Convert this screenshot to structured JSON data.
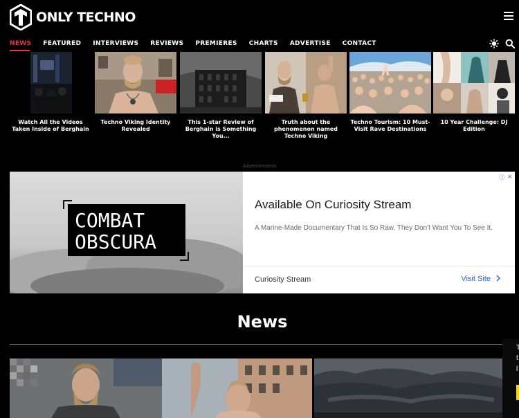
{
  "site": {
    "logo_text": "ONLY TECHNO"
  },
  "nav": {
    "items": [
      {
        "label": "NEWS",
        "active": true
      },
      {
        "label": "FEATURED"
      },
      {
        "label": "INTERVIEWS"
      },
      {
        "label": "REVIEWS"
      },
      {
        "label": "PREMIERES"
      },
      {
        "label": "CHARTS"
      },
      {
        "label": "ADVERTISE"
      },
      {
        "label": "CONTACT"
      }
    ],
    "accent_color": "#e8363a"
  },
  "carousel": {
    "cards": [
      {
        "title": "Watch All the Videos Taken Inside of Berghain"
      },
      {
        "title": "Techno Viking Identity Revealed"
      },
      {
        "title": "This 1-star Review of Berghain is Something You..."
      },
      {
        "title": "Truth about the phenomenon named Techno Viking"
      },
      {
        "title": "Techno Tourism: 10 Must-Visit Rave Destinations"
      },
      {
        "title": "10 Year Challenge: DJ Edition"
      }
    ]
  },
  "ad": {
    "label": "Advertisements",
    "image_text_line1": "COMBAT",
    "image_text_line2": "OBSCURA",
    "headline": "Available On Curiosity Stream",
    "description": "A Marine-Made Documentary That Is So Raw, They Don't Want You To See It.",
    "source": "Curiosity Stream",
    "cta": "Visit Site",
    "adchoices_glyph": "ⓘ",
    "close_glyph": "✕"
  },
  "news": {
    "heading": "News"
  },
  "side_widget": {
    "lines": [
      "T",
      "t",
      "l"
    ]
  }
}
